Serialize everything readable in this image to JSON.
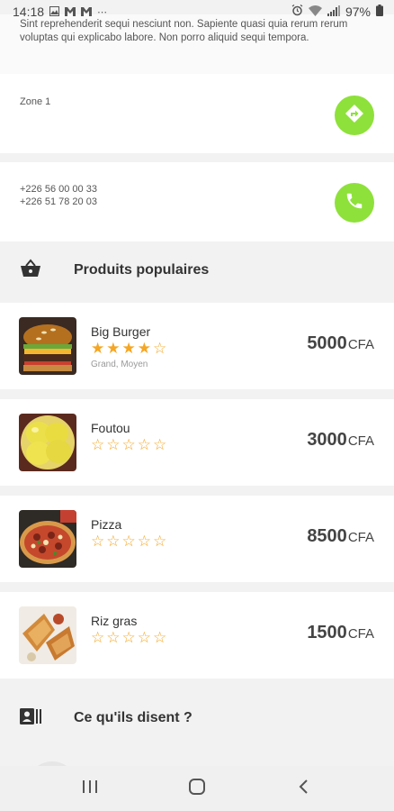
{
  "status": {
    "time": "14:18",
    "notif_icons": [
      "image-icon",
      "mail-icon",
      "mail-icon",
      "more-icon"
    ],
    "battery": "97%"
  },
  "description": "Sint reprehenderit sequi nesciunt non. Sapiente quasi quia rerum rerum voluptas qui explicabo labore. Non porro aliquid sequi tempora.",
  "zone": {
    "label": "Zone 1",
    "button_icon": "directions-icon"
  },
  "contact": {
    "phone_1": "+226 56 00 00 33",
    "phone_2": "+226 51 78 20 03",
    "button_icon": "phone-icon"
  },
  "popular_section": {
    "icon": "basket-icon",
    "title": "Produits populaires"
  },
  "products": [
    {
      "name": "Big Burger",
      "rating": 4,
      "max_rating": 5,
      "options": "Grand, Moyen",
      "price": "5000",
      "currency": "CFA",
      "image": "burger-image"
    },
    {
      "name": "Foutou",
      "rating": 0,
      "max_rating": 5,
      "options": "",
      "price": "3000",
      "currency": "CFA",
      "image": "foutou-image"
    },
    {
      "name": "Pizza",
      "rating": 0,
      "max_rating": 5,
      "options": "",
      "price": "8500",
      "currency": "CFA",
      "image": "pizza-image"
    },
    {
      "name": "Riz gras",
      "rating": 0,
      "max_rating": 5,
      "options": "",
      "price": "1500",
      "currency": "CFA",
      "image": "riz-gras-image"
    }
  ],
  "reviews_section": {
    "icon": "contact-card-icon",
    "title": "Ce qu'ils disent ?"
  },
  "nav": {
    "icons": [
      "recent-apps-icon",
      "home-icon",
      "back-icon"
    ]
  },
  "colors": {
    "accent_green": "#8ee13a",
    "star": "#f5a623",
    "background": "#f2f2f2",
    "card": "#ffffff"
  }
}
